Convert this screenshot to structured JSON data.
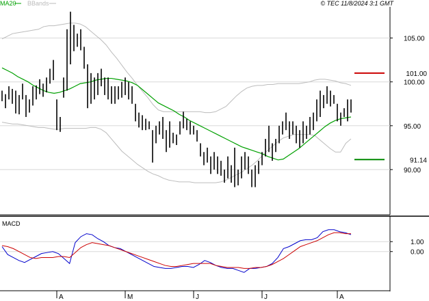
{
  "legend": {
    "ma20": "MA20",
    "bbands": "BBands",
    "ma20_color": "#00a000",
    "bbands_color": "#bbbbbb"
  },
  "watermark": "© TEC 11/8/2024 3:1 GMT",
  "macd_label": "MACD",
  "levels": {
    "resistance": {
      "label": "101.00",
      "value": 101.0,
      "color": "#cc0000"
    },
    "support": {
      "label": "91.14",
      "value": 91.14,
      "color": "#008800"
    }
  },
  "chart_data": [
    {
      "type": "ohlc",
      "price_axis": {
        "ticks": [
          90,
          95,
          100,
          105
        ],
        "tick_labels": [
          "90.00",
          "95.00",
          "100.00",
          "105.00"
        ],
        "range": [
          85.0,
          108.4
        ]
      },
      "month_labels": [
        "A",
        "M",
        "J",
        "J",
        "A"
      ],
      "month_bar_index": [
        16,
        36,
        56,
        76,
        98
      ],
      "bars": [
        [
          99.0,
          97.8
        ],
        [
          98.6,
          97.0
        ],
        [
          99.5,
          98.0
        ],
        [
          99.2,
          97.5
        ],
        [
          99.0,
          96.4
        ],
        [
          98.5,
          96.3
        ],
        [
          99.8,
          98.0
        ],
        [
          98.5,
          96.0
        ],
        [
          98.0,
          96.5
        ],
        [
          99.5,
          97.3
        ],
        [
          99.6,
          98.0
        ],
        [
          100.3,
          98.6
        ],
        [
          99.8,
          98.3
        ],
        [
          100.5,
          98.8
        ],
        [
          101.5,
          99.8
        ],
        [
          102.5,
          100.2
        ],
        [
          98.0,
          94.5
        ],
        [
          96.0,
          94.3
        ],
        [
          100.5,
          98.2
        ],
        [
          106.0,
          99.0
        ],
        [
          108.0,
          102.0
        ],
        [
          106.5,
          103.5
        ],
        [
          105.5,
          104.0
        ],
        [
          106.0,
          103.6
        ],
        [
          104.0,
          101.5
        ],
        [
          102.0,
          97.0
        ],
        [
          101.0,
          97.5
        ],
        [
          100.5,
          98.0
        ],
        [
          101.0,
          98.5
        ],
        [
          101.5,
          99.5
        ],
        [
          100.5,
          98.5
        ],
        [
          100.5,
          98.0
        ],
        [
          99.5,
          97.5
        ],
        [
          99.5,
          97.5
        ],
        [
          99.5,
          98.0
        ],
        [
          100.0,
          98.2
        ],
        [
          100.5,
          98.5
        ],
        [
          100.0,
          98.0
        ],
        [
          99.5,
          97.5
        ],
        [
          97.5,
          95.5
        ],
        [
          96.5,
          94.8
        ],
        [
          96.2,
          94.5
        ],
        [
          95.8,
          94.5
        ],
        [
          95.5,
          94.6
        ],
        [
          94.5,
          90.8
        ],
        [
          95.0,
          93.0
        ],
        [
          95.5,
          94.0
        ],
        [
          96.0,
          93.5
        ],
        [
          94.5,
          92.0
        ],
        [
          95.5,
          92.5
        ],
        [
          94.2,
          93.0
        ],
        [
          94.0,
          92.8
        ],
        [
          95.5,
          94.0
        ],
        [
          96.6,
          94.7
        ],
        [
          95.8,
          94.5
        ],
        [
          95.5,
          94.0
        ],
        [
          95.0,
          94.0
        ],
        [
          94.5,
          93.2
        ],
        [
          93.0,
          91.5
        ],
        [
          92.0,
          90.5
        ],
        [
          92.5,
          90.8
        ],
        [
          91.5,
          89.5
        ],
        [
          92.0,
          90.0
        ],
        [
          91.5,
          89.5
        ],
        [
          91.0,
          89.3
        ],
        [
          90.0,
          88.5
        ],
        [
          91.5,
          89.0
        ],
        [
          90.5,
          88.5
        ],
        [
          92.5,
          88.0
        ],
        [
          90.0,
          88.2
        ],
        [
          91.5,
          89.0
        ],
        [
          92.0,
          90.0
        ],
        [
          91.5,
          89.5
        ],
        [
          90.0,
          88.0
        ],
        [
          90.5,
          88.0
        ],
        [
          91.0,
          89.5
        ],
        [
          92.0,
          90.5
        ],
        [
          93.5,
          91.5
        ],
        [
          95.0,
          92.0
        ],
        [
          93.0,
          91.0
        ],
        [
          93.5,
          92.0
        ],
        [
          95.0,
          93.0
        ],
        [
          95.5,
          94.0
        ],
        [
          96.5,
          94.5
        ],
        [
          95.5,
          93.5
        ],
        [
          95.5,
          94.0
        ],
        [
          95.0,
          93.0
        ],
        [
          94.5,
          92.5
        ],
        [
          95.5,
          93.0
        ],
        [
          95.0,
          93.5
        ],
        [
          96.0,
          94.0
        ],
        [
          96.5,
          94.5
        ],
        [
          98.0,
          95.5
        ],
        [
          99.0,
          96.0
        ],
        [
          98.5,
          97.0
        ],
        [
          99.5,
          97.5
        ],
        [
          99.0,
          97.2
        ],
        [
          98.5,
          97.5
        ],
        [
          97.5,
          95.5
        ],
        [
          96.5,
          95.0
        ],
        [
          97.0,
          96.0
        ],
        [
          98.0,
          95.5
        ],
        [
          98.0,
          96.5
        ]
      ],
      "ma20": [
        101.6,
        101.3,
        101.0,
        100.6,
        100.3,
        100.0,
        99.6,
        99.3,
        99.0,
        98.8,
        98.7,
        98.8,
        99.0,
        99.2,
        99.5,
        99.8,
        99.9,
        100.0,
        100.2,
        100.3,
        100.4,
        100.4,
        100.3,
        100.2,
        100.1,
        99.9,
        99.6,
        99.1,
        98.6,
        98.1,
        97.6,
        97.3,
        97.0,
        96.7,
        96.3,
        96.0,
        95.6,
        95.3,
        95.0,
        94.7,
        94.4,
        94.1,
        93.8,
        93.5,
        93.2,
        92.9,
        92.6,
        92.4,
        92.2,
        92.0,
        91.8,
        91.5,
        91.3,
        91.1,
        91.2,
        91.6,
        92.0,
        92.4,
        92.9,
        93.4,
        93.9,
        94.4,
        94.9,
        95.3,
        95.6,
        95.8,
        95.9,
        96.0
      ],
      "ma20_x": [
        0,
        1,
        2,
        3,
        4,
        5,
        6,
        7,
        8,
        9,
        10,
        11,
        12,
        13,
        14,
        15,
        16,
        17,
        18,
        19,
        20,
        21,
        22,
        23,
        24,
        25,
        26,
        27,
        28,
        29,
        30,
        31,
        32,
        33,
        34,
        35,
        36,
        37,
        38,
        39,
        40,
        41,
        42,
        43,
        44,
        45,
        46,
        47,
        48,
        49,
        50,
        51,
        52,
        53,
        54,
        55,
        56,
        57,
        58,
        59,
        60,
        61,
        62,
        63,
        64,
        65,
        66,
        67
      ],
      "bb_upper": [
        104.9,
        105.2,
        105.5,
        105.6,
        105.7,
        105.8,
        105.9,
        106.0,
        106.3,
        106.4,
        106.4,
        106.5,
        106.6,
        106.7,
        106.7,
        106.6,
        106.3,
        105.8,
        105.3,
        104.8,
        104.2,
        103.4,
        102.7,
        101.9,
        101.1,
        100.4,
        99.6,
        98.9,
        98.2,
        97.4,
        96.8,
        96.6,
        96.6,
        96.6,
        96.6,
        96.6,
        96.6,
        96.6,
        96.6,
        96.5,
        96.5,
        96.6,
        96.9,
        97.2,
        97.8,
        98.4,
        98.9,
        99.3,
        99.5,
        99.6,
        99.6,
        99.7,
        99.7,
        99.8,
        99.8,
        99.8,
        99.8,
        99.8,
        99.9,
        100.0,
        100.2,
        100.3,
        100.3,
        100.2,
        100.1,
        99.9,
        99.8,
        99.6
      ],
      "bb_lower": [
        95.4,
        95.3,
        95.2,
        95.2,
        95.1,
        95.0,
        94.9,
        94.8,
        94.8,
        94.7,
        94.6,
        94.6,
        94.7,
        94.7,
        94.7,
        94.7,
        94.7,
        94.8,
        94.8,
        94.6,
        94.2,
        93.5,
        92.8,
        92.1,
        91.6,
        91.1,
        90.6,
        90.2,
        89.8,
        89.5,
        89.3,
        89.0,
        88.8,
        88.7,
        88.6,
        88.6,
        88.6,
        88.5,
        88.5,
        88.5,
        88.5,
        88.5,
        88.6,
        88.8,
        89.1,
        89.4,
        89.7,
        90.1,
        90.5,
        91.0,
        91.6,
        92.2,
        92.7,
        93.2,
        93.6,
        93.8,
        94.0,
        94.0,
        94.0,
        94.0,
        93.9,
        93.4,
        92.9,
        92.4,
        92.0,
        92.0,
        93.0,
        93.5
      ],
      "band_x": [
        0,
        1,
        2,
        3,
        4,
        5,
        6,
        7,
        8,
        9,
        10,
        11,
        12,
        13,
        14,
        15,
        16,
        17,
        18,
        19,
        20,
        21,
        22,
        23,
        24,
        25,
        26,
        27,
        28,
        29,
        30,
        31,
        32,
        33,
        34,
        35,
        36,
        37,
        38,
        39,
        40,
        41,
        42,
        43,
        44,
        45,
        46,
        47,
        48,
        49,
        50,
        51,
        52,
        53,
        54,
        55,
        56,
        57,
        58,
        59,
        60,
        61,
        62,
        63,
        64,
        65,
        66,
        67
      ]
    },
    {
      "type": "line",
      "title": "MACD",
      "y_ticks": [
        0.0,
        1.0
      ],
      "y_tick_labels": [
        "0.00",
        "1.00"
      ],
      "ylim": [
        -3.6,
        2.6
      ],
      "series": [
        {
          "color": "#0000cc",
          "values": [
            0.5,
            -0.3,
            -0.6,
            -0.9,
            -1.1,
            -0.8,
            -0.5,
            -0.2,
            -0.1,
            0.0,
            -0.2,
            -0.7,
            -1.2,
            0.9,
            1.5,
            1.8,
            1.7,
            1.3,
            1.0,
            0.6,
            0.4,
            0.3,
            0.0,
            -0.3,
            -0.6,
            -0.9,
            -1.2,
            -1.5,
            -1.6,
            -1.7,
            -1.7,
            -1.6,
            -1.5,
            -1.5,
            -1.6,
            -1.3,
            -0.9,
            -1.1,
            -1.4,
            -1.6,
            -1.7,
            -1.7,
            -1.9,
            -2.1,
            -1.7,
            -1.7,
            -1.6,
            -1.5,
            -1.2,
            -0.6,
            0.3,
            0.5,
            0.8,
            1.1,
            1.2,
            1.2,
            1.4,
            2.0,
            2.2,
            2.2,
            2.0,
            1.9,
            1.7
          ]
        },
        {
          "color": "#cc0000",
          "values": [
            0.6,
            0.5,
            0.3,
            0.0,
            -0.3,
            -0.6,
            -0.7,
            -0.6,
            -0.6,
            -0.6,
            -0.5,
            -0.5,
            -0.6,
            -0.1,
            0.4,
            0.7,
            0.9,
            0.8,
            0.7,
            0.6,
            0.4,
            0.2,
            0.0,
            -0.2,
            -0.4,
            -0.6,
            -0.8,
            -1.0,
            -1.2,
            -1.4,
            -1.5,
            -1.5,
            -1.4,
            -1.3,
            -1.2,
            -1.2,
            -1.2,
            -1.2,
            -1.4,
            -1.5,
            -1.6,
            -1.6,
            -1.6,
            -1.7,
            -1.7,
            -1.6,
            -1.6,
            -1.5,
            -1.3,
            -1.0,
            -0.7,
            -0.3,
            0.1,
            0.5,
            0.7,
            0.9,
            1.1,
            1.4,
            1.7,
            1.9,
            1.9,
            1.8,
            1.8
          ]
        }
      ]
    }
  ]
}
